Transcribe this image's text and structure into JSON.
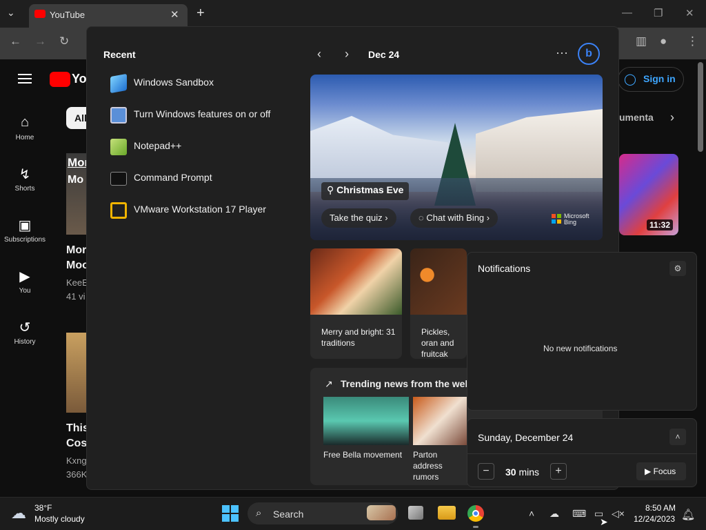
{
  "browser": {
    "tab_title": "YouTube",
    "tab_close": "✕",
    "new_tab": "+",
    "tab_list": "⌄"
  },
  "youtube": {
    "nav": [
      {
        "label": "Home",
        "icon": "⌂"
      },
      {
        "label": "Shorts",
        "icon": "↯"
      },
      {
        "label": "Subscriptions",
        "icon": "▣"
      },
      {
        "label": "You",
        "icon": "▶"
      },
      {
        "label": "History",
        "icon": "↺"
      }
    ],
    "sign_in": "Sign in",
    "chip_all": "All",
    "chip_documentary": "umenta",
    "video_duration": "11:32",
    "partial_texts": [
      "Mor",
      "Mo",
      "Mor",
      "Moo",
      "KeeE",
      "41 vi",
      "This",
      "Cos",
      "Kxng",
      "366K"
    ]
  },
  "panel": {
    "recent_title": "Recent",
    "recent_items": [
      {
        "label": "Windows Sandbox",
        "icon": "sandbox-icon",
        "color": "#3a8fe0"
      },
      {
        "label": "Turn Windows features on or off",
        "icon": "windows-features-icon",
        "color": "#5a8fd8"
      },
      {
        "label": "Notepad++",
        "icon": "notepad-plus-plus-icon",
        "color": "#8bc34a"
      },
      {
        "label": "Command Prompt",
        "icon": "command-prompt-icon",
        "color": "#2b2b2b"
      },
      {
        "label": "VMware Workstation 17 Player",
        "icon": "vmware-icon",
        "color": "#f0b400"
      }
    ],
    "date": "Dec 24",
    "hero": {
      "badge": "Christmas Eve",
      "quiz_btn": "Take the quiz",
      "chat_btn": "Chat with Bing",
      "brand_line1": "Microsoft",
      "brand_line2": "Bing"
    },
    "cards": [
      {
        "text": "Merry and bright: 31 traditions"
      },
      {
        "text": "Pickles, oran and fruitcak"
      }
    ],
    "trending_title": "Trending news from the web",
    "trending": [
      {
        "text": "Free Bella movement"
      },
      {
        "text": "Parton address rumors"
      }
    ]
  },
  "notifications": {
    "title": "Notifications",
    "empty": "No new notifications",
    "calendar_date": "Sunday, December 24",
    "focus_minutes": "30",
    "focus_unit": "mins",
    "focus_label": "Focus"
  },
  "taskbar": {
    "weather_temp": "38°F",
    "weather_desc": "Mostly cloudy",
    "search_label": "Search",
    "time": "8:50 AM",
    "date": "12/24/2023"
  }
}
